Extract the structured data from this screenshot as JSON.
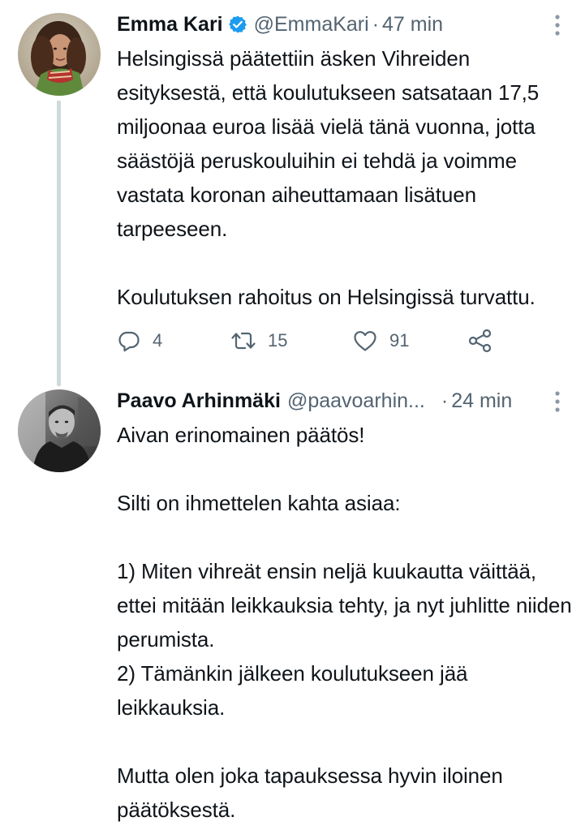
{
  "thread": {
    "tweets": [
      {
        "author_name": "Emma Kari",
        "verified": true,
        "handle": "@EmmaKari",
        "separator": "·",
        "time": "47 min",
        "paragraphs": [
          "Helsingissä päätettiin äsken Vihreiden esityksestä, että koulutukseen satsataan 17,5 miljoonaa euroa lisää vielä tänä vuonna, jotta säästöjä peruskouluihin ei tehdä ja voimme vastata koronan aiheuttamaan lisätuen tarpeeseen.",
          "",
          "Koulutuksen rahoitus on Helsingissä turvattu."
        ],
        "actions": {
          "reply_count": "4",
          "retweet_count": "15",
          "like_count": "91"
        },
        "icons": {
          "reply": "reply-icon",
          "retweet": "retweet-icon",
          "like": "heart-icon",
          "share": "share-icon",
          "more": "more-vertical-icon",
          "verified": "verified-badge-icon"
        }
      },
      {
        "author_name": "Paavo Arhinmäki",
        "verified": false,
        "handle": "@paavoarhin...",
        "separator": "·",
        "time": "24 min",
        "paragraphs": [
          "Aivan erinomainen päätös!",
          "",
          "Silti on ihmettelen kahta asiaa:",
          "",
          "1) Miten vihreät ensin neljä kuukautta väittää, ettei mitään leikkauksia tehty, ja nyt juhlitte niiden perumista.",
          "2) Tämänkin jälkeen koulutukseen jää leikkauksia.",
          "",
          "Mutta olen joka tapauksessa hyvin iloinen päätöksestä."
        ],
        "icons": {
          "more": "more-vertical-icon"
        }
      }
    ]
  },
  "colors": {
    "text_primary": "#0f1419",
    "text_secondary": "#536471",
    "verified_blue": "#1d9bf0",
    "thread_line": "#cfd9de",
    "background": "#ffffff"
  }
}
